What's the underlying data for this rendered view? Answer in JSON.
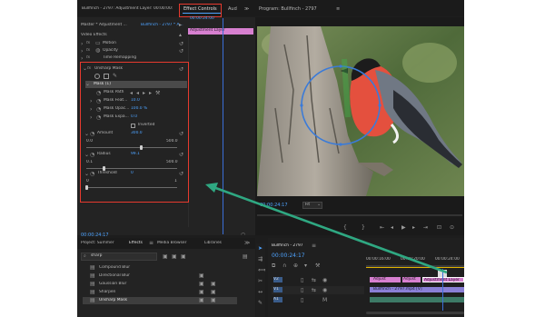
{
  "top_bar": {
    "source_tab": "Bullfinch - 2797: Adjustment Layer: 00:00:00:00",
    "effect_controls_tab": "Effect Controls",
    "audio_tab": "Aud",
    "program_tab": "Program: Bullfinch - 2797"
  },
  "effect_controls": {
    "master_label": "Master * Adjustment ...",
    "sequence_label": "Bullfinch - 2797 * A...",
    "adjustment_clip": "Adjustment Layer",
    "timecode_small": "00:00:24:00",
    "video_effects": "Video Effects",
    "effects": [
      {
        "name": "Motion"
      },
      {
        "name": "Opacity"
      },
      {
        "name": "Time Remapping"
      }
    ],
    "unsharp": {
      "name": "Unsharp Mask",
      "mask_label": "Mask (1)",
      "mask_path": "Mask Path",
      "mask_feather": "Mask Feat...",
      "mask_feather_val": "10.0",
      "mask_opacity": "Mask Opac...",
      "mask_opacity_val": "100.0 %",
      "mask_expansion": "Mask Expa...",
      "mask_expansion_val": "0.0",
      "inverted": "Inverted",
      "amount": "Amount",
      "amount_val": "300.0",
      "amount_min": "0.0",
      "amount_max": "500.0",
      "radius": "Radius",
      "radius_val": "99.1",
      "radius_min": "0.1",
      "radius_max": "500.0",
      "threshold": "Threshold",
      "threshold_val": "0",
      "threshold_min": "0",
      "threshold_max": "1"
    },
    "bottom_timecode": "00:00:24:17"
  },
  "program": {
    "timecode": "00:00:24:17",
    "fit": "Fit"
  },
  "project": {
    "tabs": [
      "Project: Summer",
      "Effects",
      "Media Browser",
      "Libraries"
    ],
    "search_value": "sharp",
    "items": [
      "Compound Blur",
      "Directional Blur",
      "Gaussian Blur",
      "Sharpen",
      "Unsharp Mask"
    ]
  },
  "timeline": {
    "tab": "Bullfinch - 2797",
    "timecode": "00:00:24:17",
    "ruler": [
      "00:00:16:00",
      "00:00:20:00",
      "00:00:24:00"
    ],
    "tracks": [
      "V2",
      "V1",
      "A1"
    ],
    "clips": {
      "adjust_1": "Adjust",
      "adjust_2": "Adjust",
      "adjustment_layer": "Adjustment Layer",
      "video_clip": "Bullfinch - 2797.mp4 [V]"
    }
  },
  "colors": {
    "highlight_box": "#e63a2e",
    "arrow": "#2fa882",
    "accent_blue": "#4ea3ff",
    "clip_pink": "#d780d0",
    "clip_purple": "#8a7fd6"
  }
}
